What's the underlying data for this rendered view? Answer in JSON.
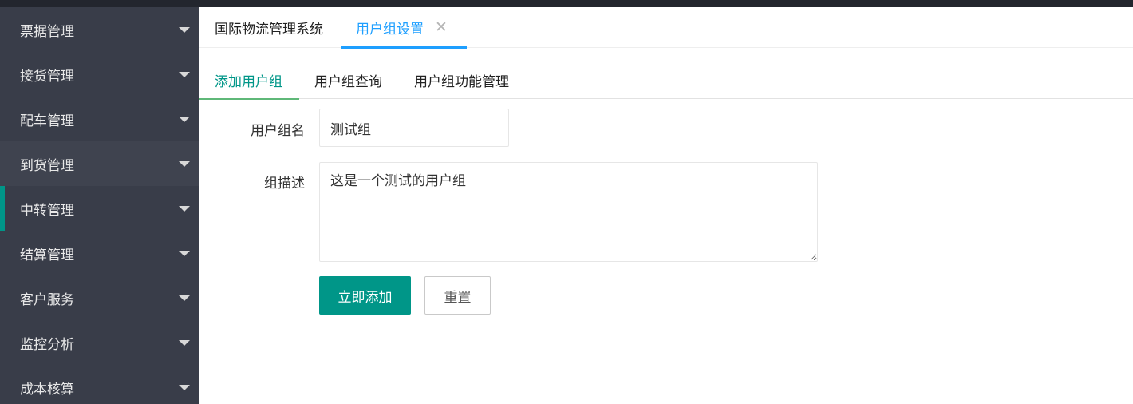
{
  "sidebar": {
    "items": [
      {
        "label": "票据管理"
      },
      {
        "label": "接货管理"
      },
      {
        "label": "配车管理"
      },
      {
        "label": "到货管理"
      },
      {
        "label": "中转管理"
      },
      {
        "label": "结算管理"
      },
      {
        "label": "客户服务"
      },
      {
        "label": "监控分析"
      },
      {
        "label": "成本核算"
      }
    ],
    "hover_item": "到货管理",
    "active_indicator_item": "中转管理",
    "arrow_icon": "caret-down-icon",
    "background_color": "#393d49",
    "indicator_color": "#009688"
  },
  "tabs": {
    "home_label": "国际物流管理系统",
    "current_label": "用户组设置",
    "close_icon": "close-icon",
    "active_color": "#1e9fff"
  },
  "subtabs": {
    "items": [
      {
        "label": "添加用户组"
      },
      {
        "label": "用户组查询"
      },
      {
        "label": "用户组功能管理"
      }
    ],
    "active_index": 0,
    "active_color": "#009688"
  },
  "form": {
    "name_label": "用户组名",
    "name_value": "测试组",
    "desc_label": "组描述",
    "desc_value": "这是一个测试的用户组",
    "submit_label": "立即添加",
    "reset_label": "重置",
    "submit_color": "#009688"
  }
}
